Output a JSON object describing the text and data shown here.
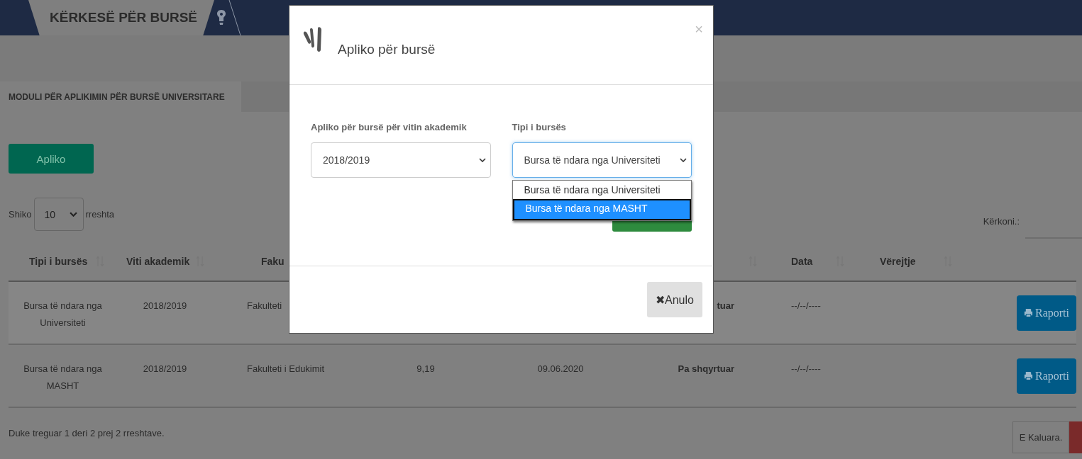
{
  "header": {
    "tab_title": "KËRKESË PËR BURSË"
  },
  "section": {
    "title": "MODULI PËR APLIKIMIN PËR BURSË UNIVERSITARE"
  },
  "apply_button": "Apliko",
  "page_length": {
    "prefix": "Shiko",
    "value": "10",
    "suffix": "rreshta"
  },
  "search": {
    "label": "Kërkoni.:"
  },
  "table": {
    "columns": [
      {
        "label": "Tipi i bursës",
        "sortable": true
      },
      {
        "label": "Viti akademik",
        "sortable": true
      },
      {
        "label": "Faku"
      },
      {},
      {},
      {
        "sortable": true
      },
      {
        "label": "Data",
        "sortable": true
      },
      {
        "label": "Vërejtje",
        "sortable": true
      },
      {}
    ],
    "rows": [
      {
        "type": "Bursa të ndara nga Universiteti",
        "year": "2018/2019",
        "faculty": "Fakulteti",
        "status": "tuar",
        "data": "--/--/----",
        "action": "Raporti"
      },
      {
        "type": "Bursa të ndara nga MASHT",
        "year": "2018/2019",
        "faculty": "Fakulteti i Edukimit",
        "column_4": "9,19",
        "column_5": "09.06.2020",
        "status": "Pa shqyrtuar",
        "data": "--/--/----",
        "action": "Raporti"
      }
    ]
  },
  "footer": {
    "info": "Duke treguar 1 deri 2 prej 2 rreshtave.",
    "previous_button": "E Kaluara."
  },
  "modal": {
    "title": "Apliko për bursë",
    "close": "×",
    "fields": [
      {
        "label": "Apliko për bursë për vitin akademik",
        "value": "2018/2019",
        "focused": false
      },
      {
        "label": "Tipi i bursës",
        "value": "Bursa të ndara nga Universiteti",
        "focused": true,
        "options": [
          {
            "label": "Bursa të ndara nga Universiteti",
            "highlighted": false
          },
          {
            "label": "Bursa të ndara nga MASHT",
            "highlighted": true
          }
        ]
      }
    ],
    "cancel_button": {
      "icon": "✖",
      "label": "Anulo"
    }
  }
}
